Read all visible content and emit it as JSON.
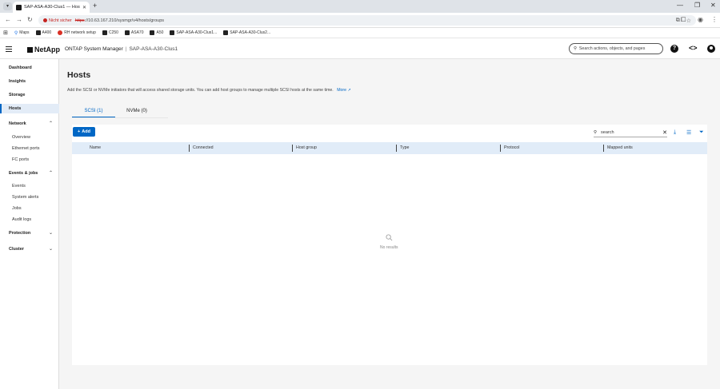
{
  "browser": {
    "tab_title": "SAP-ASA-A30-Clus1 — Hosts",
    "tab_close": "✕",
    "new_tab": "+",
    "security_warning": "Nicht sicher",
    "url_scheme": "https",
    "url_rest": "://10.63.167.210/sysmgr/v4/hosts/groups",
    "window_controls": [
      "—",
      "❐",
      "✕"
    ]
  },
  "bookmarks": [
    {
      "label": "Maps",
      "icon": "map-pin-icon"
    },
    {
      "label": "A400",
      "icon": "netapp-icon"
    },
    {
      "label": "RH network setup",
      "icon": "redhat-icon"
    },
    {
      "label": "C250",
      "icon": "netapp-icon"
    },
    {
      "label": "ASA70",
      "icon": "netapp-icon"
    },
    {
      "label": "A50",
      "icon": "netapp-icon"
    },
    {
      "label": "SAP-ASA-A30-Clus1...",
      "icon": "netapp-icon"
    },
    {
      "label": "SAP-ASA-A30-Clus2...",
      "icon": "netapp-icon"
    }
  ],
  "header": {
    "brand": "NetApp",
    "product": "ONTAP System Manager",
    "separator": "|",
    "cluster": "SAP-ASA-A30-Clus1",
    "search_placeholder": "Search actions, objects, and pages"
  },
  "sidebar": {
    "items": [
      {
        "label": "Dashboard"
      },
      {
        "label": "Insights"
      },
      {
        "label": "Storage"
      },
      {
        "label": "Hosts",
        "active": true
      },
      {
        "label": "Network",
        "expanded": true
      },
      {
        "label": "Overview"
      },
      {
        "label": "Ethernet ports"
      },
      {
        "label": "FC ports"
      },
      {
        "label": "Events & jobs",
        "expanded": true
      },
      {
        "label": "Events"
      },
      {
        "label": "System alerts"
      },
      {
        "label": "Jobs"
      },
      {
        "label": "Audit logs"
      },
      {
        "label": "Protection"
      },
      {
        "label": "Cluster"
      }
    ]
  },
  "main": {
    "title": "Hosts",
    "description": "Add the SCSI or NVMe initiators that will access shared storage units. You can add host groups to manage multiple SCSI hosts at the same time.",
    "more_link": "More",
    "tabs": [
      {
        "label": "SCSI (1)",
        "active": true
      },
      {
        "label": "NVMe (0)",
        "active": false
      }
    ],
    "add_button": "Add",
    "table_search_value": "search",
    "columns": [
      "Name",
      "Connected",
      "Host group",
      "Type",
      "Protocol",
      "Mapped units"
    ],
    "empty_text": "No results"
  },
  "colors": {
    "accent": "#0067c5",
    "header_row": "#e1ecf8",
    "warning": "#c5221f"
  }
}
